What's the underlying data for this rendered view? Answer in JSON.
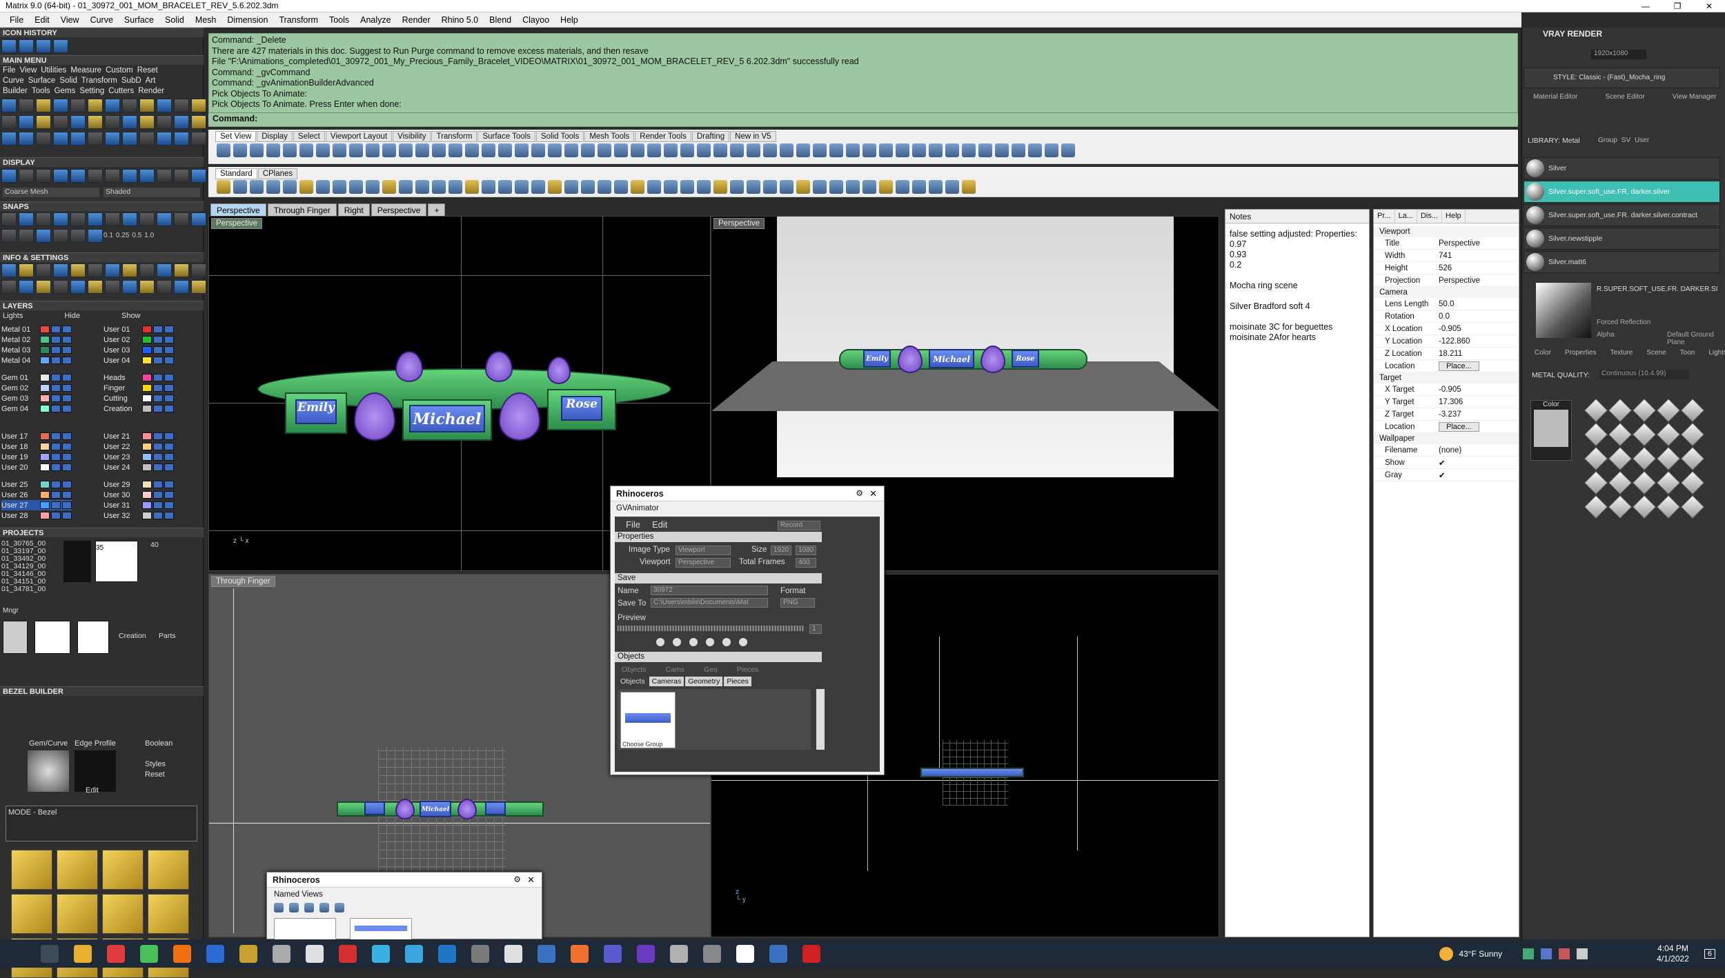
{
  "window": {
    "title": "Matrix 9.0 (64-bit) - 01_30972_001_MOM_BRACELET_REV_5.6.202.3dm",
    "controls": [
      "—",
      "❐",
      "✕"
    ]
  },
  "menubar": [
    "File",
    "Edit",
    "View",
    "Curve",
    "Surface",
    "Solid",
    "Mesh",
    "Dimension",
    "Transform",
    "Tools",
    "Analyze",
    "Render",
    "Rhino 5.0",
    "Blend",
    "Clayoo",
    "Help"
  ],
  "left": {
    "icon_history": "ICON HISTORY",
    "main_menu": "MAIN MENU",
    "main_menu_row1": [
      "File",
      "View",
      "Utilities",
      "Measure",
      "Custom",
      "Reset"
    ],
    "main_menu_row2": [
      "Curve",
      "Surface",
      "Solid",
      "Transform",
      "SubD",
      "Art"
    ],
    "main_menu_row3": [
      "Builder",
      "Tools",
      "Gems",
      "Setting",
      "Cutters",
      "Render"
    ],
    "display": "DISPLAY",
    "display_mesh": "Coarse Mesh",
    "display_mode": "Shaded",
    "snaps": "SNAPS",
    "snap_values": [
      "0.1",
      "0.25",
      "0.5",
      "1.0"
    ],
    "info_settings": "INFO & SETTINGS",
    "layers": "LAYERS",
    "layers_header": [
      "Lights",
      "Hide",
      "Show"
    ],
    "layers_left": [
      "Metal 01",
      "Metal 02",
      "Metal 03",
      "Metal 04",
      "Gem 01",
      "Gem 02",
      "Gem 03",
      "Gem 04",
      "User 17",
      "User 18",
      "User 19",
      "User 20",
      "User 25",
      "User 26",
      "User 27",
      "User 28"
    ],
    "layers_right": [
      "User 01",
      "User 02",
      "User 03",
      "User 04",
      "Heads",
      "Finger",
      "Cutting",
      "Creation",
      "User 21",
      "User 22",
      "User 23",
      "User 24",
      "User 29",
      "User 30",
      "User 31",
      "User 32"
    ],
    "projects": "PROJECTS",
    "project_list": [
      "01_30765_00",
      "01_33197_00",
      "01_33492_00",
      "01_34129_00",
      "01_34146_00",
      "01_34151_00",
      "01_34781_00"
    ],
    "project_nums": [
      "35",
      "40"
    ],
    "proj_tabs": [
      "Mngr",
      "Creation",
      "Parts"
    ],
    "bezel_builder": "BEZEL BUILDER",
    "bezel_cols": [
      "Gem/Curve",
      "Edge Profile"
    ],
    "bezel_opts": [
      "Boolean",
      "Styles",
      "Reset"
    ],
    "bezel_edit": "Edit",
    "bezel_mode": "MODE - Bezel"
  },
  "command": {
    "lines": [
      "Command: _Delete",
      "There are 427 materials in this doc. Suggest to Run Purge command to remove excess materials, and then resave",
      "File \"F:\\Animations_completed\\01_30972_001_My_Precious_Family_Bracelet_VIDEO\\MATRIX\\01_30972_001_MOM_BRACELET_REV_5 6.202.3dm\" successfully read",
      "Command: _gvCommand",
      "Command: _gvAnimationBuilderAdvanced",
      "Pick Objects To Animate:",
      "Pick Objects To Animate. Press Enter when done:"
    ],
    "prompt": "Command:"
  },
  "toolbar_tabs": [
    "Set View",
    "Display",
    "Select",
    "Viewport Layout",
    "Visibility",
    "Transform",
    "Surface Tools",
    "Solid Tools",
    "Mesh Tools",
    "Render Tools",
    "Drafting",
    "New in V5"
  ],
  "std_tabs": [
    "Standard",
    "CPlanes"
  ],
  "viewport_tabs": [
    "Perspective",
    "Through Finger",
    "Right",
    "Perspective",
    "+"
  ],
  "viewports": {
    "top_left": "Perspective",
    "top_right": "Perspective",
    "bottom_left": "Through Finger"
  },
  "bracelet_names": [
    "Emily",
    "Michael",
    "Rose"
  ],
  "notes": {
    "tab": "Notes",
    "lines": [
      "false setting  adjusted: Properties:",
      "0.97",
      "0.93",
      "0.2",
      "",
      "Mocha ring scene",
      "",
      "Silver Bradford soft 4",
      "",
      "moisinate 3C for beguettes",
      "moisinate 2Afor hearts"
    ]
  },
  "properties": {
    "tabs": [
      "Pr...",
      "La...",
      "Dis...",
      "Help"
    ],
    "viewport_grp": "Viewport",
    "viewport": [
      [
        "Title",
        "Perspective"
      ],
      [
        "Width",
        "741"
      ],
      [
        "Height",
        "526"
      ],
      [
        "Projection",
        "Perspective"
      ]
    ],
    "camera_grp": "Camera",
    "camera": [
      [
        "Lens Length",
        "50.0"
      ],
      [
        "Rotation",
        "0.0"
      ],
      [
        "X Location",
        "-0.905"
      ],
      [
        "Y Location",
        "-122.860"
      ],
      [
        "Z Location",
        "18.211"
      ],
      [
        "Location",
        "Place..."
      ]
    ],
    "target_grp": "Target",
    "target": [
      [
        "X Target",
        "-0.905"
      ],
      [
        "Y Target",
        "17.306"
      ],
      [
        "Z Target",
        "-3.237"
      ],
      [
        "Location",
        "Place..."
      ]
    ],
    "wallpaper_grp": "Wallpaper",
    "wallpaper": [
      [
        "Filename",
        "(none)"
      ],
      [
        "Show",
        "✔"
      ],
      [
        "Gray",
        "✔"
      ]
    ]
  },
  "vray": {
    "title": "VRAY RENDER",
    "resolution": "1920x1080",
    "style": "STYLE: Classic - (Fast)_Mocha_ring",
    "tabs": [
      "Material Editor",
      "Scene Editor",
      "View Manager"
    ],
    "library": "LIBRARY: Metal",
    "library_opts": [
      "Group",
      "SV",
      "User"
    ],
    "materials": [
      "Silver",
      "Silver.super.soft_use.FR. darker.silver",
      "Silver.super.soft_use.FR. darker.silver.contract",
      "Silver.newstipple",
      "Silver.matt6"
    ],
    "selected_name": "R.SUPER.SOFT_USE.FR. DARKER.SI",
    "reflection": "Forced Reflection",
    "alpha": "Alpha",
    "ground": "Default Ground Plane",
    "subtabs": [
      "Color",
      "Properties",
      "Texture",
      "Scene",
      "Toon",
      "Lights"
    ],
    "quality_label": "METAL QUALITY:",
    "quality_value": "Continuous   (10.4.99)",
    "color_label": "Color"
  },
  "rhino_dialog": {
    "title": "Rhinoceros",
    "plugin": "GVAnimator",
    "menus": [
      "File",
      "Edit"
    ],
    "record": "Record",
    "properties": "Properties",
    "image_type_label": "Image Type",
    "image_type": "Viewport",
    "size_label": "Size",
    "size_w": "1920",
    "size_h": "1080",
    "viewport_label": "Viewport",
    "viewport": "Perspective",
    "frames_label": "Total Frames",
    "frames": "400",
    "save": "Save",
    "name_label": "Name",
    "name": "30972",
    "format_label": "Format",
    "saveto_label": "Save To",
    "saveto": "C:\\Users\\mbils\\Documents\\Mat",
    "format": "PNG",
    "preview": "Preview",
    "frame": "1",
    "objects": "Objects",
    "obj_buttons": [
      "Objects",
      "Cams",
      "Geo",
      "Pieces"
    ],
    "obj_tabs": [
      "Objects",
      "Cameras",
      "Geometry",
      "Pieces"
    ],
    "thumb_label": "Choose Group"
  },
  "named_views": {
    "title": "Rhinoceros",
    "tab": "Named Views"
  },
  "taskbar": {
    "weather": "43°F  Sunny",
    "time": "4:04 PM",
    "date": "4/1/2022",
    "notif": "6"
  },
  "colors": {
    "command_bg": "#9cc7a0",
    "link_green": "#4cc06a",
    "plate_blue": "#5575e0",
    "heart_purple": "#9a70e0",
    "vray_select": "#3fbfb1"
  }
}
